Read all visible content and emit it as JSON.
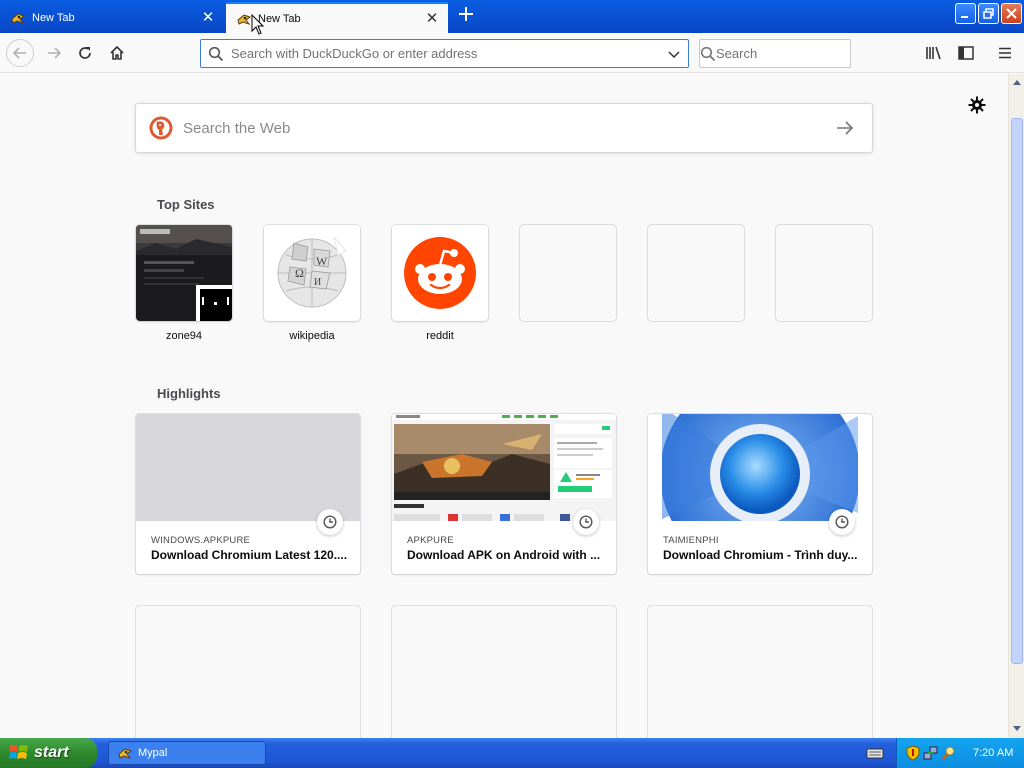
{
  "window": {
    "tabs": [
      {
        "title": "New Tab",
        "active": false
      },
      {
        "title": "New Tab",
        "active": true
      }
    ],
    "new_tab_icon": "plus-icon",
    "controls": [
      "minimize-icon",
      "maximize-icon",
      "close-icon"
    ]
  },
  "toolbar": {
    "back_icon": "back-arrow-icon",
    "forward_icon": "forward-arrow-icon",
    "reload_icon": "reload-icon",
    "home_icon": "home-icon",
    "url_placeholder": "Search with DuckDuckGo or enter address",
    "url_value": "",
    "search_placeholder": "Search",
    "library_icon": "library-icon",
    "sidebar_icon": "sidebar-icon",
    "menu_icon": "hamburger-menu-icon"
  },
  "newtab": {
    "web_search_placeholder": "Search the Web",
    "top_sites_title": "Top Sites",
    "top_sites": [
      {
        "label": "zone94"
      },
      {
        "label": "wikipedia"
      },
      {
        "label": "reddit"
      },
      {
        "label": ""
      },
      {
        "label": ""
      },
      {
        "label": ""
      }
    ],
    "highlights_title": "Highlights",
    "highlights": [
      {
        "host": "WINDOWS.APKPURE",
        "title": "Download Chromium Latest 120...."
      },
      {
        "host": "APKPURE",
        "title": "Download APK on Android with ..."
      },
      {
        "host": "TAIMIENPHI",
        "title": "Download Chromium - Trình duy..."
      }
    ]
  },
  "taskbar": {
    "start_label": "start",
    "task_label": "Mypal",
    "clock": "7:20 AM"
  },
  "colors": {
    "tabstrip": "#0a4fd2",
    "accent": "#0a84ff",
    "reddit": "#ff4500",
    "ddg": "#de5833",
    "start_green": "#2d8a2d"
  }
}
